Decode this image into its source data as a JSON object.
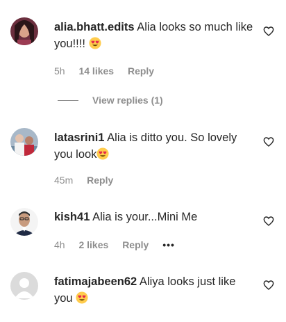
{
  "comments": [
    {
      "username": "alia.bhatt.edits",
      "text": "Alia looks so much like you!!!!",
      "emoji": "heart-eyes",
      "time": "5h",
      "likes": "14 likes",
      "reply": "Reply",
      "view_replies": "View replies (1)"
    },
    {
      "username": "latasrini1",
      "text": "Alia is ditto you. So lovely you look",
      "emoji": "heart-eyes",
      "time": "45m",
      "reply": "Reply"
    },
    {
      "username": "kish41",
      "text": "Alia is your...Mini Me",
      "time": "4h",
      "likes": "2 likes",
      "reply": "Reply",
      "more": "•••"
    },
    {
      "username": "fatimajabeen62",
      "text": "Aliya looks just like you",
      "emoji": "heart-eyes"
    }
  ],
  "icons": {
    "like": "heart-outline-icon",
    "emoji": "smiling-face-with-heart-eyes-emoji",
    "more": "more-options-icon"
  }
}
